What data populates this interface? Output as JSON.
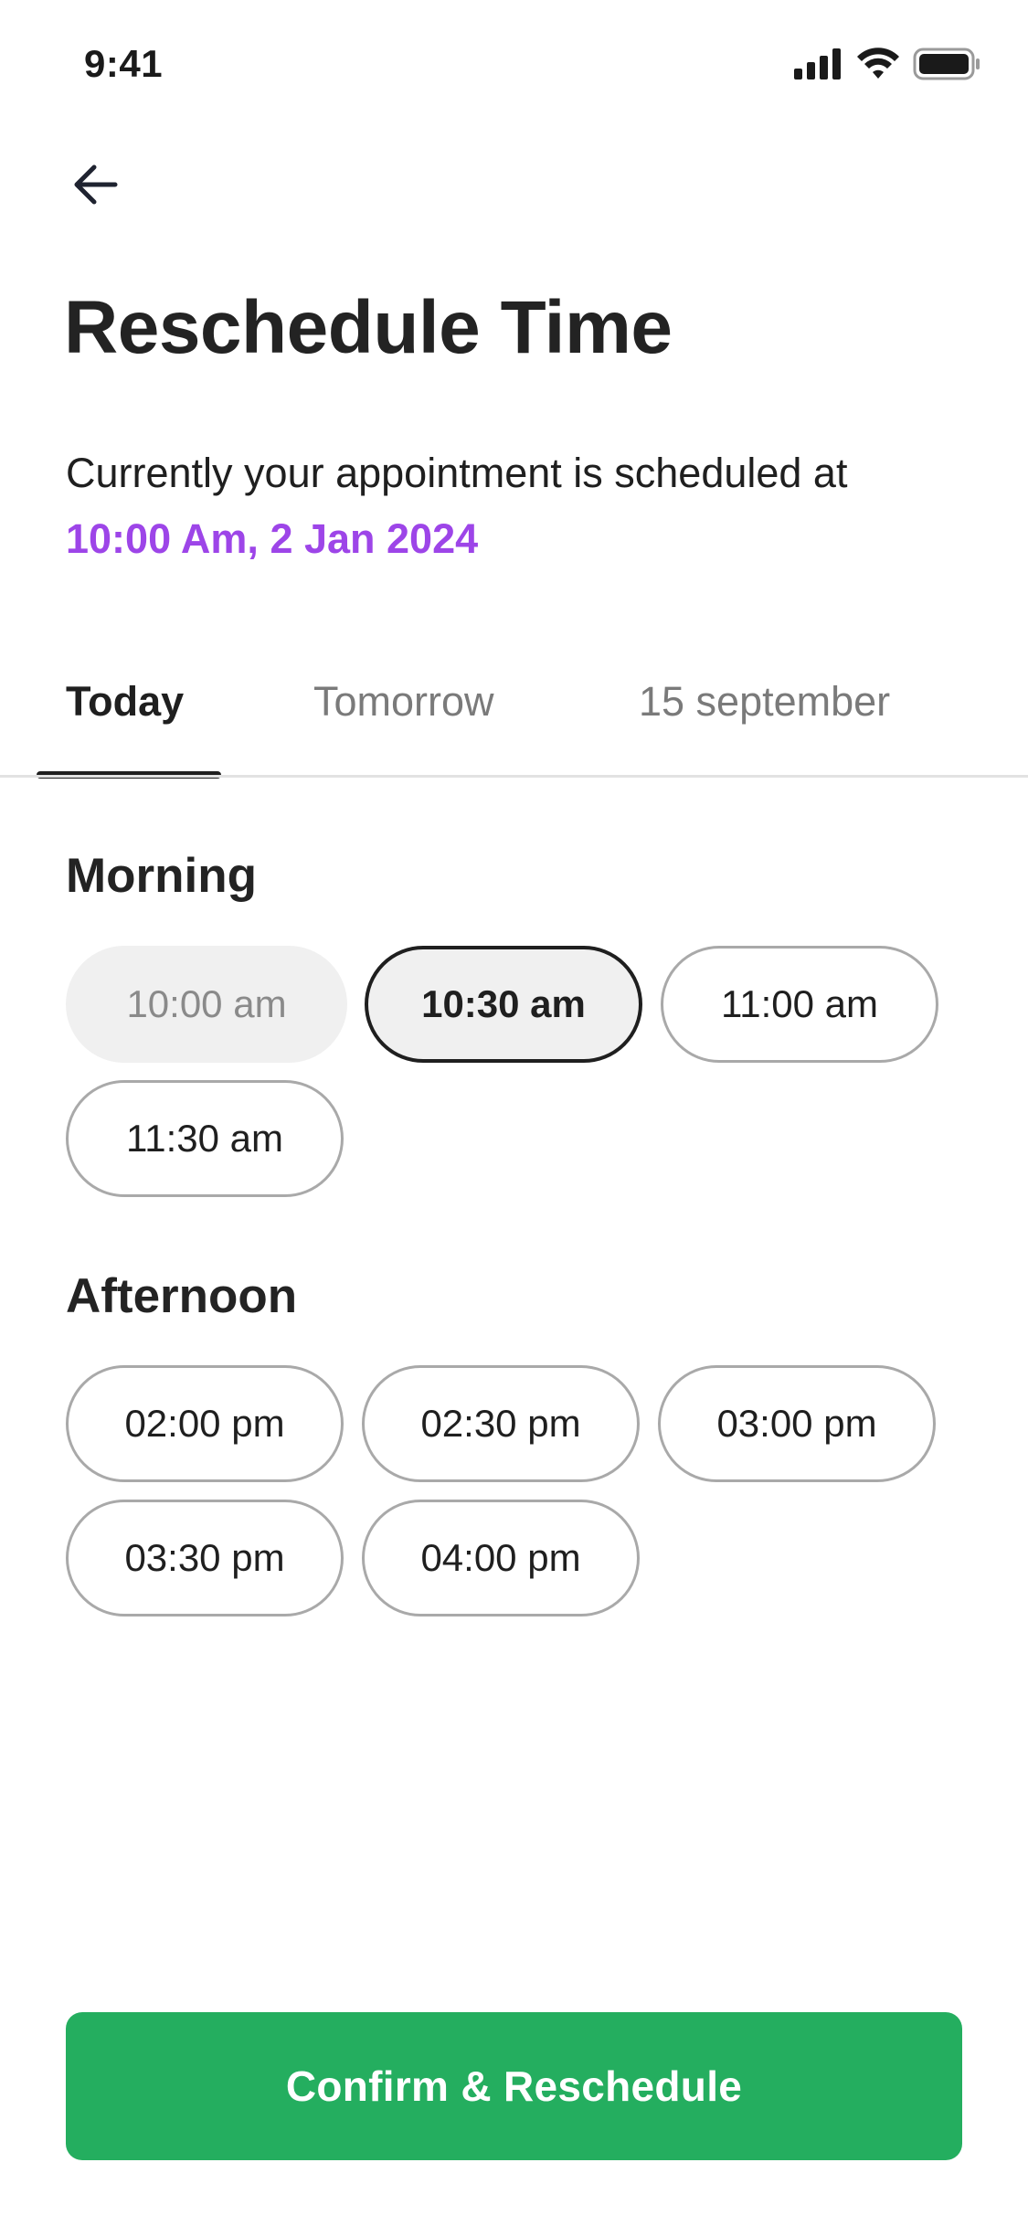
{
  "status_bar": {
    "time": "9:41",
    "icons": [
      "signal-icon",
      "wifi-icon",
      "battery-icon"
    ]
  },
  "header": {
    "back_icon": "arrow-left-icon",
    "title": "Reschedule Time"
  },
  "subtitle": {
    "prefix": "Currently your appointment is scheduled at",
    "highlight": "10:00 Am, 2 Jan 2024"
  },
  "tabs": [
    {
      "label": "Today",
      "active": true
    },
    {
      "label": "Tomorrow",
      "active": false
    },
    {
      "label": "15 september",
      "active": false
    }
  ],
  "sections": {
    "morning": {
      "title": "Morning",
      "slots": [
        {
          "label": "10:00 am",
          "state": "disabled"
        },
        {
          "label": "10:30 am",
          "state": "selected"
        },
        {
          "label": "11:00 am",
          "state": "default"
        },
        {
          "label": "11:30 am",
          "state": "default"
        }
      ]
    },
    "afternoon": {
      "title": "Afternoon",
      "slots": [
        {
          "label": "02:00 pm",
          "state": "default"
        },
        {
          "label": "02:30 pm",
          "state": "default"
        },
        {
          "label": "03:00 pm",
          "state": "default"
        },
        {
          "label": "03:30 pm",
          "state": "default"
        },
        {
          "label": "04:00 pm",
          "state": "default"
        }
      ]
    }
  },
  "confirm_button": {
    "label": "Confirm & Reschedule"
  },
  "colors": {
    "accent_purple": "#9d45e8",
    "primary_green": "#24ae5f",
    "text_dark": "#1f1f1f",
    "text_muted": "#7a7a7a"
  }
}
